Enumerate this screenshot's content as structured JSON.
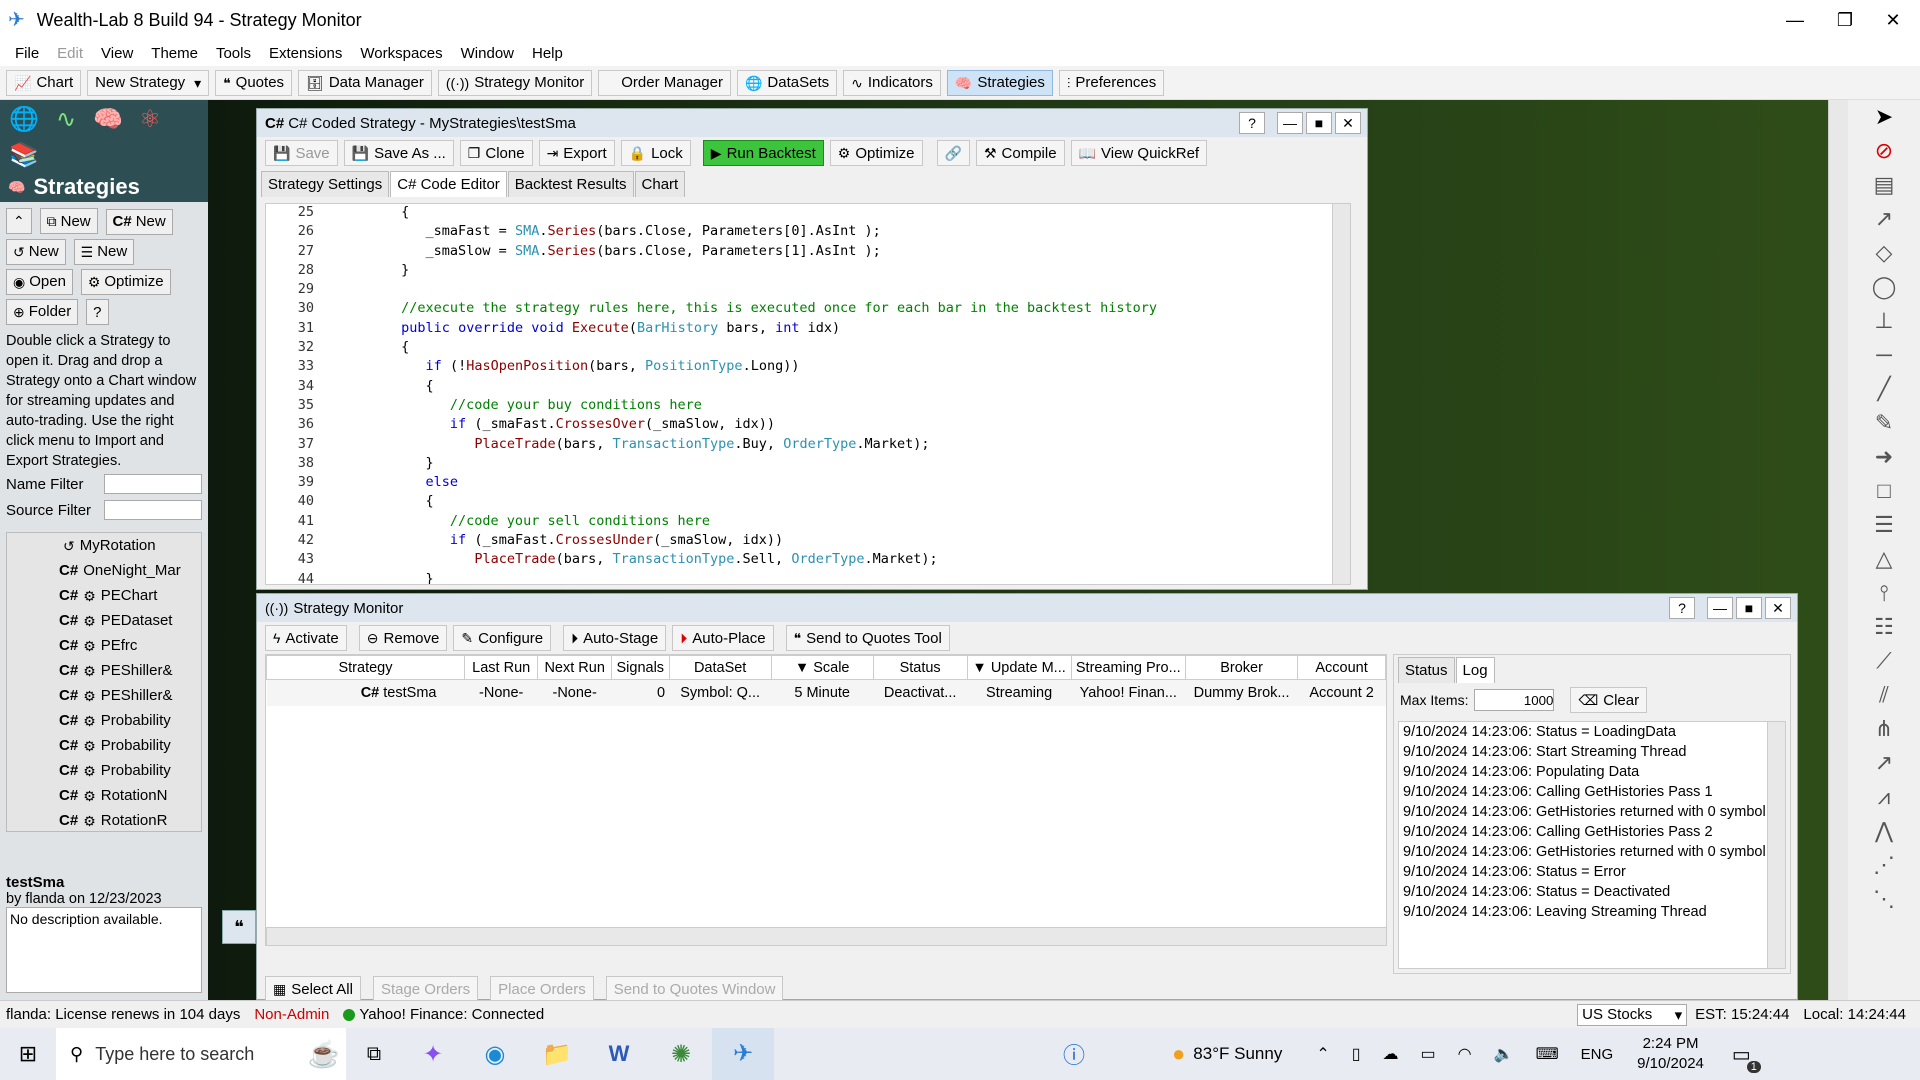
{
  "app": {
    "title": "Wealth-Lab 8 Build 94 - Strategy Monitor"
  },
  "menu": [
    "File",
    "Edit",
    "View",
    "Theme",
    "Tools",
    "Extensions",
    "Workspaces",
    "Window",
    "Help"
  ],
  "toolbar": {
    "chart": "Chart",
    "new_strategy": "New Strategy",
    "quotes": "Quotes",
    "data_manager": "Data Manager",
    "strategy_monitor": "Strategy Monitor",
    "order_manager": "Order Manager",
    "datasets": "DataSets",
    "indicators": "Indicators",
    "strategies": "Strategies",
    "preferences": "Preferences"
  },
  "left": {
    "header": "Strategies",
    "btn_new1": "New",
    "btn_new2": "New",
    "btn_new3": "New",
    "btn_new4": "New",
    "btn_open": "Open",
    "btn_optimize": "Optimize",
    "btn_folder": "Folder",
    "btn_help": "?",
    "hint": "Double click a Strategy to open it. Drag and drop a Strategy onto a Chart window for streaming updates and auto-trading. Use the right click menu to Import and Export Strategies.",
    "name_filter": "Name Filter",
    "source_filter": "Source Filter",
    "items": [
      "MyRotation",
      "OneNight_Mar",
      "PEChart",
      "PEDataset",
      "PEfrc",
      "PEShiller&",
      "PEShiller&",
      "Probability",
      "Probability",
      "Probability",
      "RotationN",
      "RotationR"
    ],
    "selected_name": "testSma",
    "selected_by": "by flanda on 12/23/2023",
    "selected_desc": "No description available."
  },
  "editor": {
    "title": "C# Coded Strategy - MyStrategies\\testSma",
    "btn_save": "Save",
    "btn_save_as": "Save As ...",
    "btn_clone": "Clone",
    "btn_export": "Export",
    "btn_lock": "Lock",
    "btn_run": "Run Backtest",
    "btn_optimize": "Optimize",
    "btn_compile": "Compile",
    "btn_quickref": "View QuickRef",
    "tabs": [
      "Strategy Settings",
      "C# Code Editor",
      "Backtest Results",
      "Chart"
    ],
    "lines": [
      {
        "n": "25",
        "t": "         {"
      },
      {
        "n": "26",
        "t": "            _smaFast = SMA.Series(bars.Close, Parameters[0].AsInt );"
      },
      {
        "n": "27",
        "t": "            _smaSlow = SMA.Series(bars.Close, Parameters[1].AsInt );"
      },
      {
        "n": "28",
        "t": "         }"
      },
      {
        "n": "29",
        "t": ""
      },
      {
        "n": "30",
        "t": "         //execute the strategy rules here, this is executed once for each bar in the backtest history"
      },
      {
        "n": "31",
        "t": "         public override void Execute(BarHistory bars, int idx)"
      },
      {
        "n": "32",
        "t": "         {"
      },
      {
        "n": "33",
        "t": "            if (!HasOpenPosition(bars, PositionType.Long))"
      },
      {
        "n": "34",
        "t": "            {"
      },
      {
        "n": "35",
        "t": "               //code your buy conditions here"
      },
      {
        "n": "36",
        "t": "               if (_smaFast.CrossesOver(_smaSlow, idx))"
      },
      {
        "n": "37",
        "t": "                  PlaceTrade(bars, TransactionType.Buy, OrderType.Market);"
      },
      {
        "n": "38",
        "t": "            }"
      },
      {
        "n": "39",
        "t": "            else"
      },
      {
        "n": "40",
        "t": "            {"
      },
      {
        "n": "41",
        "t": "               //code your sell conditions here"
      },
      {
        "n": "42",
        "t": "               if (_smaFast.CrossesUnder(_smaSlow, idx))"
      },
      {
        "n": "43",
        "t": "                  PlaceTrade(bars, TransactionType.Sell, OrderType.Market);"
      },
      {
        "n": "44",
        "t": "            }"
      }
    ]
  },
  "monitor": {
    "title": "Strategy Monitor",
    "btn_activate": "Activate",
    "btn_remove": "Remove",
    "btn_configure": "Configure",
    "btn_autostage": "Auto-Stage",
    "btn_autoplace": "Auto-Place",
    "btn_send": "Send to Quotes Tool",
    "columns": [
      "Strategy",
      "Last Run",
      "Next Run",
      "Signals",
      "DataSet",
      "Scale",
      "Status",
      "Update M...",
      "Streaming Pro...",
      "Broker",
      "Account"
    ],
    "row": [
      "testSma",
      "-None-",
      "-None-",
      "0",
      "Symbol: Q...",
      "5 Minute",
      "Deactivat...",
      "Streaming",
      "Yahoo! Finan...",
      "Dummy Brok...",
      "Account 2"
    ],
    "btn_select_all": "Select All",
    "btn_stage": "Stage Orders",
    "btn_place": "Place Orders",
    "btn_send_window": "Send to Quotes Window",
    "right_tabs": [
      "Status",
      "Log"
    ],
    "max_items_label": "Max Items:",
    "max_items": "1000",
    "btn_clear": "Clear",
    "log": [
      "9/10/2024 14:23:06: Status = LoadingData",
      "9/10/2024 14:23:06: Start Streaming Thread",
      "9/10/2024 14:23:06: Populating Data",
      "9/10/2024 14:23:06: Calling GetHistories Pass 1",
      "9/10/2024 14:23:06: GetHistories returned with 0 symbol",
      "9/10/2024 14:23:06: Calling GetHistories Pass 2",
      "9/10/2024 14:23:06: GetHistories returned with 0 symbol",
      "9/10/2024 14:23:06: Status = Error",
      "9/10/2024 14:23:06: Status = Deactivated",
      "9/10/2024 14:23:06: Leaving Streaming Thread"
    ]
  },
  "status": {
    "license": "flanda: License renews in 104 days",
    "admin": "Non-Admin",
    "conn": "Yahoo! Finance: Connected",
    "market": "US Stocks",
    "est": "EST: 15:24:44",
    "local": "Local: 14:24:44"
  },
  "taskbar": {
    "search": "Type here to search",
    "weather": "83°F  Sunny",
    "lang": "ENG",
    "time": "2:24 PM",
    "date": "9/10/2024",
    "notif": "1"
  }
}
